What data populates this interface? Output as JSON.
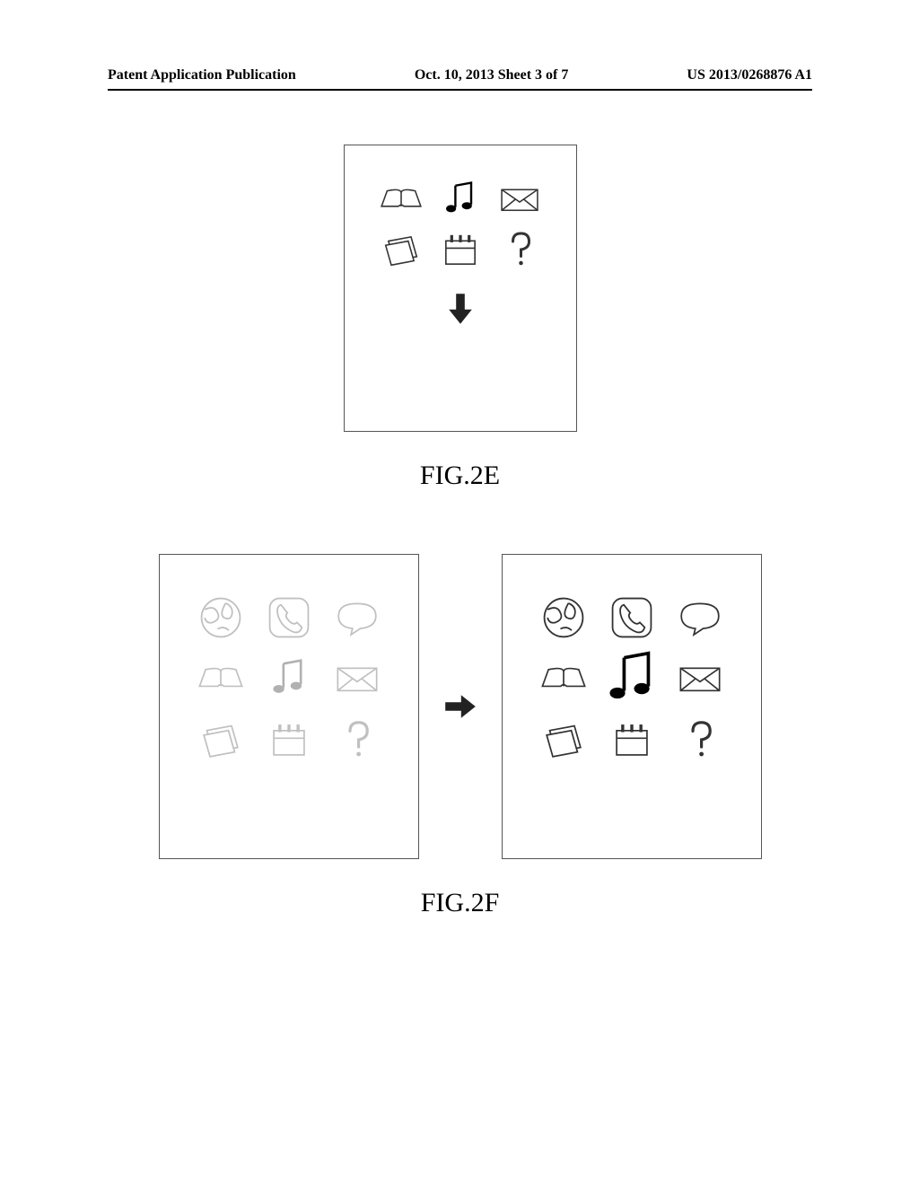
{
  "header": {
    "left": "Patent Application Publication",
    "center": "Oct. 10, 2013  Sheet 3 of 7",
    "right": "US 2013/0268876 A1"
  },
  "captions": {
    "fig2e": "FIG.2E",
    "fig2f": "FIG.2F"
  }
}
